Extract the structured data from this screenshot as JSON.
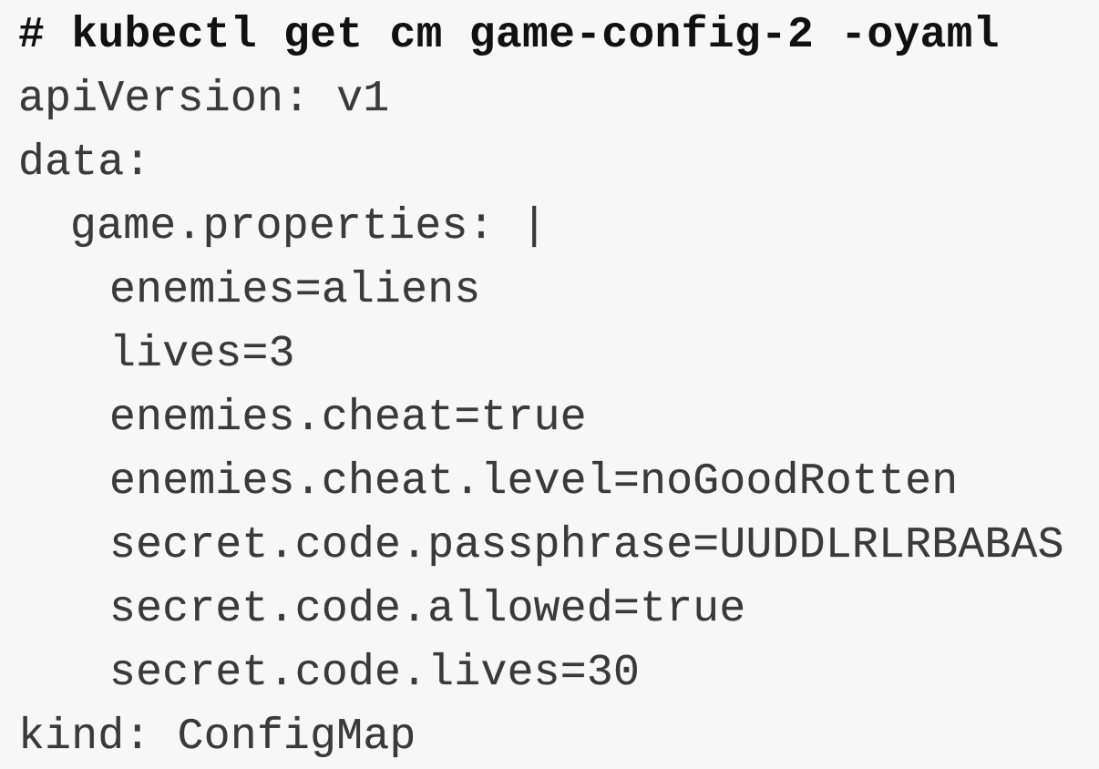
{
  "terminal": {
    "command": "# kubectl get cm game-config-2 -oyaml",
    "lines": {
      "api_version": "apiVersion: v1",
      "data_key": "data:",
      "game_properties": "game.properties: |",
      "enemies": "enemies=aliens",
      "lives": "lives=3",
      "enemies_cheat": "enemies.cheat=true",
      "enemies_cheat_level": "enemies.cheat.level=noGoodRotten",
      "secret_code_passphrase": "secret.code.passphrase=UUDDLRLRBABAS",
      "secret_code_allowed": "secret.code.allowed=true",
      "secret_code_lives": "secret.code.lives=30",
      "kind": "kind: ConfigMap"
    }
  }
}
